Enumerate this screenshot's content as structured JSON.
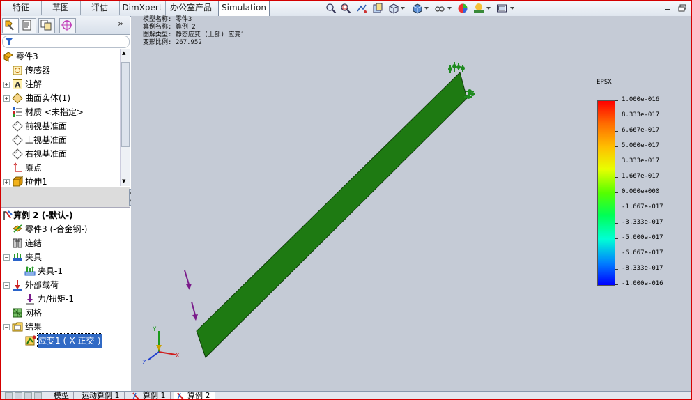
{
  "command_manager": {
    "tabs": [
      "特征",
      "草图",
      "评估",
      "DimXpert",
      "办公室产品",
      "Simulation"
    ],
    "active_tab": "Simulation",
    "view_toolbar_icons": [
      "zoom-to-fit-icon",
      "zoom-to-area-icon",
      "previous-view-icon",
      "section-view-icon",
      "view-orientation-icon",
      "display-style-icon",
      "hide-show-items-icon",
      "edit-appearance-icon",
      "apply-scene-icon",
      "view-settings-icon"
    ],
    "window_controls": [
      "minimize-icon",
      "restore-icon"
    ]
  },
  "feature_manager": {
    "tab_icons": [
      "feature-manager-icon",
      "property-manager-icon",
      "configuration-manager-icon",
      "dimxpert-manager-icon"
    ],
    "expand_glyph": "»",
    "items": [
      {
        "label": "零件3",
        "icon": "part-icon",
        "expander": ""
      },
      {
        "label": "传感器",
        "icon": "sensor-icon",
        "expander": ""
      },
      {
        "label": "注解",
        "icon": "annotation-icon",
        "expander": "+"
      },
      {
        "label": "曲面实体(1)",
        "icon": "surface-body-icon",
        "expander": "+"
      },
      {
        "label": "材质 <未指定>",
        "icon": "material-icon",
        "expander": ""
      },
      {
        "label": "前视基准面",
        "icon": "plane-icon",
        "expander": ""
      },
      {
        "label": "上视基准面",
        "icon": "plane-icon",
        "expander": ""
      },
      {
        "label": "右视基准面",
        "icon": "plane-icon",
        "expander": ""
      },
      {
        "label": "原点",
        "icon": "origin-icon",
        "expander": ""
      },
      {
        "label": "拉伸1",
        "icon": "extrude-icon",
        "expander": "+"
      }
    ]
  },
  "simulation_tree": {
    "study_title": "算例 2 (-默认-)",
    "items": [
      {
        "label": "零件3 (-合金钢-)",
        "icon": "part-material-icon",
        "indent": 1,
        "expander": ""
      },
      {
        "label": "连结",
        "icon": "connections-icon",
        "indent": 1,
        "expander": ""
      },
      {
        "label": "夹具",
        "icon": "fixtures-icon",
        "indent": 1,
        "expander": "−"
      },
      {
        "label": "夹具-1",
        "icon": "fixed-geometry-icon",
        "indent": 2,
        "expander": ""
      },
      {
        "label": "外部载荷",
        "icon": "external-loads-icon",
        "indent": 1,
        "expander": "−"
      },
      {
        "label": "力/扭矩-1",
        "icon": "force-icon",
        "indent": 2,
        "expander": ""
      },
      {
        "label": "网格",
        "icon": "mesh-icon",
        "indent": 1,
        "expander": ""
      },
      {
        "label": "结果",
        "icon": "results-folder-icon",
        "indent": 1,
        "expander": "−"
      },
      {
        "label": "应变1 (-X 正交-)",
        "icon": "strain-plot-icon",
        "indent": 2,
        "expander": "",
        "selected": true
      }
    ]
  },
  "plot_info": {
    "lines": [
      "模型名称: 零件3",
      "算例名称: 算例 2",
      "图解类型: 静态应变 (上部) 应变1",
      "变形比例: 267.952"
    ]
  },
  "legend": {
    "title": "EPSX",
    "values": [
      "1.000e-016",
      "8.333e-017",
      "6.667e-017",
      "5.000e-017",
      "3.333e-017",
      "1.667e-017",
      "0.000e+000",
      "-1.667e-017",
      "-3.333e-017",
      "-5.000e-017",
      "-6.667e-017",
      "-8.333e-017",
      "-1.000e-016"
    ]
  },
  "model": {
    "body_color": "#1e7a12",
    "fixture_color": "#1e8a1e",
    "load_arrow_color": "#7a1a8a"
  },
  "triad": {
    "x": "X",
    "y": "Y",
    "z": "Z"
  },
  "bottom_tabs": [
    "模型",
    "运动算例 1",
    "算例 1",
    "算例 2"
  ],
  "active_bottom_tab": "算例 2"
}
